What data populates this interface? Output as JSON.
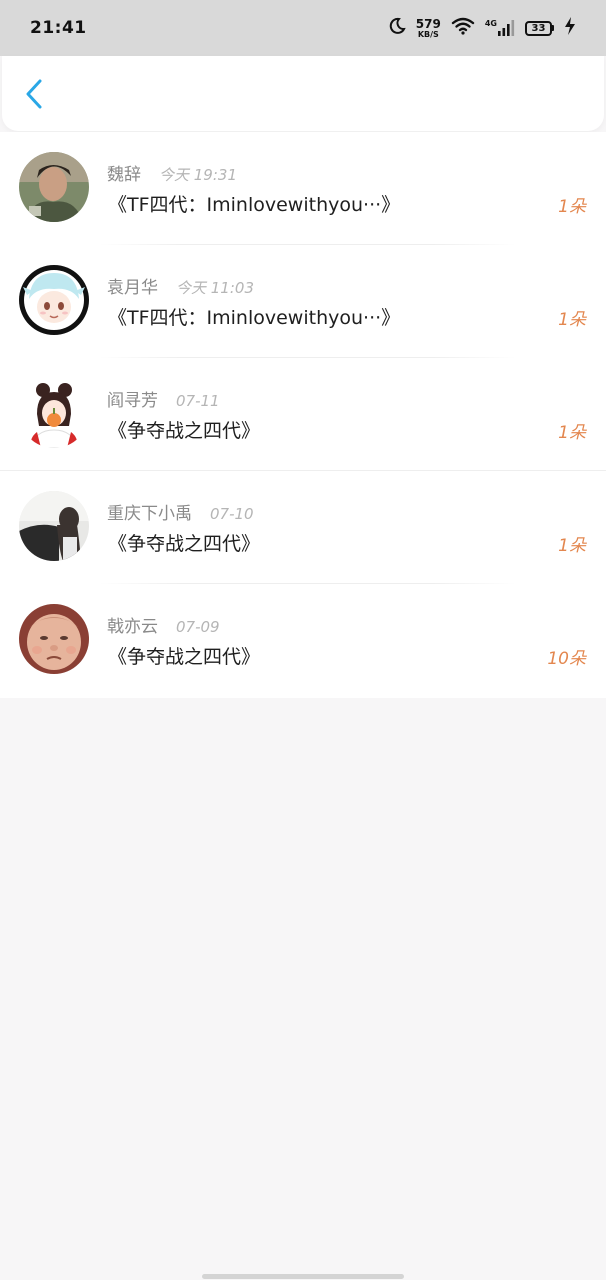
{
  "status_bar": {
    "time": "21:41",
    "speed_value": "579",
    "speed_unit": "KB/S",
    "network_type": "4G",
    "battery_level": "33",
    "icons": [
      "moon-icon",
      "wifi-icon",
      "signal-icon",
      "battery-icon",
      "charging-icon"
    ]
  },
  "nav_bar": {
    "back_icon": "chevron-left-icon",
    "accent_color": "#2aa7e6"
  },
  "list": {
    "items": [
      {
        "name": "魏辞",
        "time": "今天 19:31",
        "title": "《TF四代：Iminlovewithyou···》",
        "count": "1朵",
        "avatar": "avatar-photo-man"
      },
      {
        "name": "袁月华",
        "time": "今天 11:03",
        "title": "《TF四代：Iminlovewithyou···》",
        "count": "1朵",
        "avatar": "avatar-anime-white-hair"
      },
      {
        "name": "阎寻芳",
        "time": "07-11",
        "title": "《争夺战之四代》",
        "count": "1朵",
        "avatar": "avatar-cartoon-girl"
      },
      {
        "name": "重庆下小禹",
        "time": "07-10",
        "title": "《争夺战之四代》",
        "count": "1朵",
        "avatar": "avatar-photo-girl-back"
      },
      {
        "name": "戟亦云",
        "time": "07-09",
        "title": "《争夺战之四代》",
        "count": "10朵",
        "avatar": "avatar-photo-baby"
      }
    ]
  },
  "colors": {
    "count_color": "#e3874f",
    "name_color": "#8a8a8a",
    "time_color": "#b5b5b5"
  }
}
